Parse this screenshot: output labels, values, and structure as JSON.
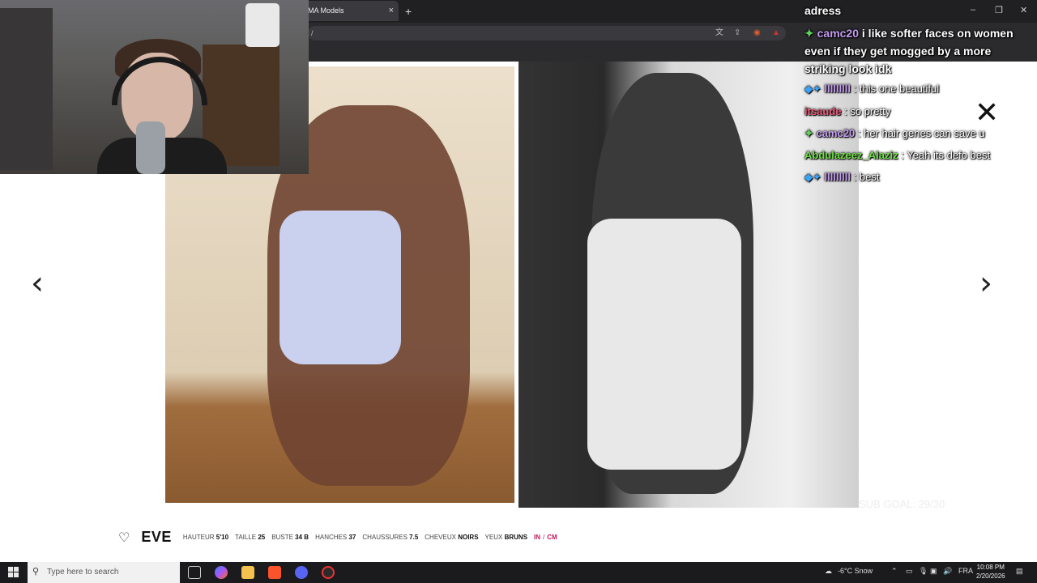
{
  "browser": {
    "tab_label": "MA Models",
    "tab_close": "×",
    "new_tab": "+",
    "url_text": "/",
    "window_controls": [
      "–",
      "❐",
      "✕"
    ]
  },
  "chat": {
    "title": "adress",
    "messages": [
      {
        "badges": "✦",
        "user": "camc20",
        "text": "i like softer faces on women even if they get mogged by a more striking look idk"
      },
      {
        "badges": "◆✦",
        "user": "lllllllll",
        "text": " : this one beautiful"
      },
      {
        "badges": "",
        "user": "itsaude",
        "text": " : so pretty"
      },
      {
        "badges": "✦",
        "user": "camc20",
        "text": " : her hair genes can save u"
      },
      {
        "badges": "",
        "user": "Abdulazeez_Alaziz",
        "text": " : Yeah its defo best"
      },
      {
        "badges": "◆✦",
        "user": "lllllllll",
        "text": " : best"
      }
    ],
    "sub_goal": "SUB GOAL: 29/30"
  },
  "gallery": {
    "prev_arrow": "‹",
    "next_arrow": "›",
    "close": "✕"
  },
  "model": {
    "name": "EVE",
    "heart": "♡",
    "stats": [
      {
        "label": "HAUTEUR",
        "value": "5'10"
      },
      {
        "label": "TAILLE",
        "value": "25"
      },
      {
        "label": "BUSTE",
        "value": "34 B"
      },
      {
        "label": "HANCHES",
        "value": "37"
      },
      {
        "label": "CHAUSSURES",
        "value": "7.5"
      },
      {
        "label": "CHEVEUX",
        "value": "NOIRS"
      },
      {
        "label": "YEUX",
        "value": "BRUNS"
      }
    ],
    "unit_in": "IN",
    "unit_sep": "/",
    "unit_cm": "CM"
  },
  "taskbar": {
    "search_placeholder": "Type here to search",
    "weather": "-6°C  Snow",
    "language": "FRA",
    "time": "10:08 PM",
    "date": "2/20/2026"
  }
}
